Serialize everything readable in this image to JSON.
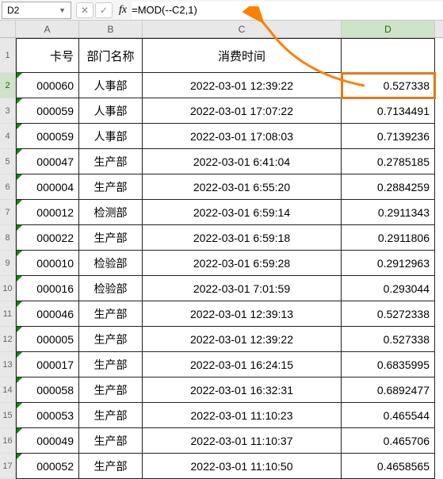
{
  "nameBox": "D2",
  "formula": "=MOD(--C2,1)",
  "columns": {
    "A": "A",
    "B": "B",
    "C": "C",
    "D": "D"
  },
  "headers": {
    "A": "卡号",
    "B": "部门名称",
    "C": "消费时间",
    "D": ""
  },
  "rows": [
    {
      "n": "2",
      "A": "000060",
      "B": "人事部",
      "C": "2022-03-01 12:39:22",
      "D": "0.527338"
    },
    {
      "n": "3",
      "A": "000059",
      "B": "人事部",
      "C": "2022-03-01 17:07:22",
      "D": "0.7134491"
    },
    {
      "n": "4",
      "A": "000059",
      "B": "人事部",
      "C": "2022-03-01 17:08:03",
      "D": "0.7139236"
    },
    {
      "n": "5",
      "A": "000047",
      "B": "生产部",
      "C": "2022-03-01 6:41:04",
      "D": "0.2785185"
    },
    {
      "n": "6",
      "A": "000004",
      "B": "生产部",
      "C": "2022-03-01 6:55:20",
      "D": "0.2884259"
    },
    {
      "n": "7",
      "A": "000012",
      "B": "检测部",
      "C": "2022-03-01 6:59:14",
      "D": "0.2911343"
    },
    {
      "n": "8",
      "A": "000022",
      "B": "生产部",
      "C": "2022-03-01 6:59:18",
      "D": "0.2911806"
    },
    {
      "n": "9",
      "A": "000010",
      "B": "检验部",
      "C": "2022-03-01 6:59:28",
      "D": "0.2912963"
    },
    {
      "n": "10",
      "A": "000016",
      "B": "检验部",
      "C": "2022-03-01 7:01:59",
      "D": "0.293044"
    },
    {
      "n": "11",
      "A": "000046",
      "B": "生产部",
      "C": "2022-03-01 12:39:13",
      "D": "0.5272338"
    },
    {
      "n": "12",
      "A": "000005",
      "B": "生产部",
      "C": "2022-03-01 12:39:22",
      "D": "0.527338"
    },
    {
      "n": "13",
      "A": "000017",
      "B": "生产部",
      "C": "2022-03-01 16:24:15",
      "D": "0.6835995"
    },
    {
      "n": "14",
      "A": "000058",
      "B": "生产部",
      "C": "2022-03-01 16:32:31",
      "D": "0.6892477"
    },
    {
      "n": "15",
      "A": "000053",
      "B": "生产部",
      "C": "2022-03-01 11:10:23",
      "D": "0.465544"
    },
    {
      "n": "16",
      "A": "000049",
      "B": "生产部",
      "C": "2022-03-01 11:10:37",
      "D": "0.465706"
    },
    {
      "n": "17",
      "A": "000052",
      "B": "生产部",
      "C": "2022-03-01 11:10:50",
      "D": "0.4658565"
    }
  ]
}
